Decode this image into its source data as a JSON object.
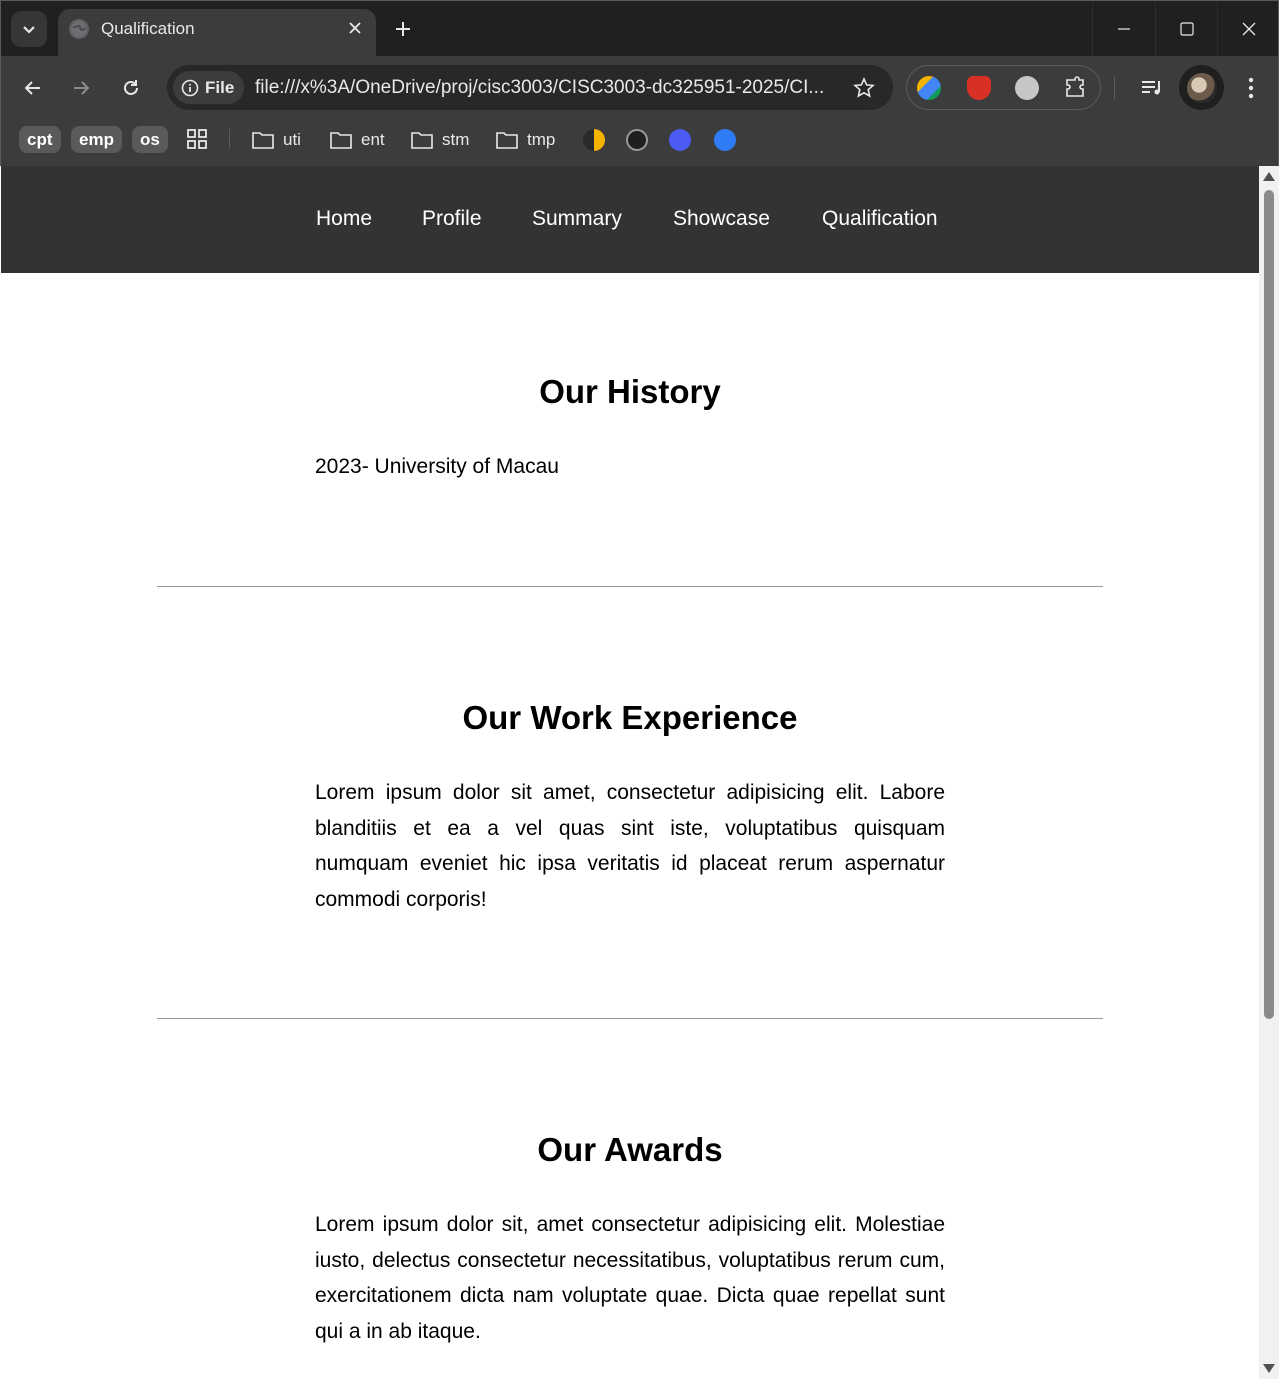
{
  "browser": {
    "tab_title": "Qualification",
    "site_chip_label": "File",
    "url": "file:///x%3A/OneDrive/proj/cisc3003/CISC3003-dc325951-2025/CI...",
    "bookmarks": {
      "chips": [
        "cpt",
        "emp",
        "os"
      ],
      "folders": [
        "uti",
        "ent",
        "stm",
        "tmp"
      ]
    },
    "icons": {
      "tab_search": "chevron-down-icon",
      "favicon": "globe-icon",
      "tab_close": "close-icon",
      "new_tab": "plus-icon",
      "back": "arrow-left-icon",
      "forward": "arrow-right-icon",
      "reload": "reload-icon",
      "site_info": "info-icon",
      "bookmark_star": "star-icon",
      "extensions": "puzzle-icon",
      "media": "media-queue-icon",
      "menu": "kebab-menu-icon",
      "apps": "apps-grid-icon",
      "folder": "folder-icon"
    }
  },
  "site": {
    "nav": [
      "Home",
      "Profile",
      "Summary",
      "Showcase",
      "Qualification"
    ],
    "sections": [
      {
        "title": "Our History",
        "body": "2023- University of Macau"
      },
      {
        "title": "Our Work Experience",
        "body": "Lorem ipsum dolor sit amet, consectetur adipisicing elit. Labore blanditiis et ea a vel quas sint iste, voluptatibus quisquam numquam eveniet hic ipsa veritatis id placeat rerum aspernatur commodi corporis!"
      },
      {
        "title": "Our Awards",
        "body": "Lorem ipsum dolor sit, amet consectetur adipisicing elit. Molestiae iusto, delectus consectetur necessitatibus, voluptatibus rerum cum, exercitationem dicta nam voluptate quae. Dicta quae repellat sunt qui a in ab itaque."
      }
    ]
  },
  "colors": {
    "nav_background": "#333333",
    "page_background": "#ffffff",
    "browser_frame": "#3c3c3c"
  }
}
